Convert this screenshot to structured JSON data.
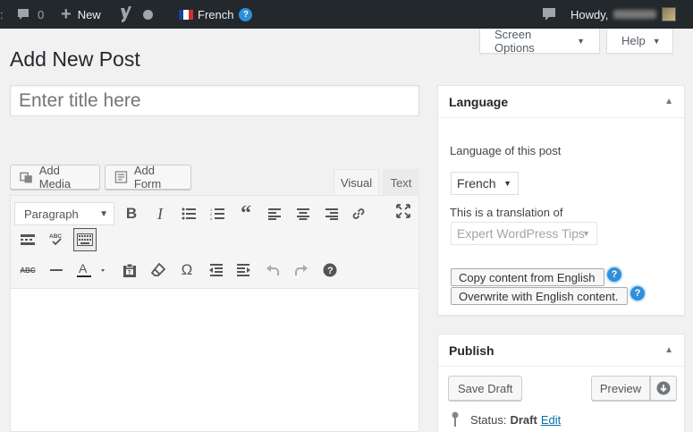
{
  "adminbar": {
    "comments_count": "0",
    "new_label": "New",
    "language_label": "French",
    "howdy_label": "Howdy,"
  },
  "screen_meta": {
    "screen_options_label": "Screen Options",
    "help_label": "Help"
  },
  "page": {
    "title": "Add New Post",
    "title_placeholder": "Enter title here"
  },
  "media_buttons": {
    "add_media_label": "Add Media",
    "add_form_label": "Add Form"
  },
  "editor": {
    "tabs": [
      {
        "label": "Visual",
        "active": true
      },
      {
        "label": "Text",
        "active": false
      }
    ],
    "format_select_value": "Paragraph",
    "toolbar_row1_icons": [
      "bold-icon",
      "italic-icon",
      "bulleted-list-icon",
      "numbered-list-icon",
      "blockquote-icon",
      "align-left-icon",
      "align-center-icon",
      "align-right-icon",
      "insert-link-icon",
      "fullscreen-icon"
    ],
    "toolbar_row2_icons": [
      "read-more-icon",
      "spellcheck-icon",
      "toolbar-toggle-icon"
    ],
    "toolbar_row3_icons": [
      "strikethrough-icon",
      "horizontal-line-icon",
      "text-color-icon",
      "paste-as-text-icon",
      "clear-formatting-icon",
      "special-character-icon",
      "outdent-icon",
      "indent-icon",
      "undo-icon",
      "redo-icon",
      "keyboard-shortcuts-icon"
    ]
  },
  "language_box": {
    "title": "Language",
    "language_label": "Language of this post",
    "language_value": "French",
    "translation_label": "This is a translation of",
    "translation_value": "Expert WordPress Tips",
    "copy_button_label": "Copy content from English",
    "overwrite_button_label": "Overwrite with English content."
  },
  "publish_box": {
    "title": "Publish",
    "save_draft_label": "Save Draft",
    "preview_label": "Preview",
    "status_label": "Status:",
    "status_value": "Draft",
    "edit_label": "Edit"
  },
  "colors": {
    "adminbar_bg": "#23282d",
    "link": "#0073aa",
    "help_icon": "#2f8fd8"
  }
}
